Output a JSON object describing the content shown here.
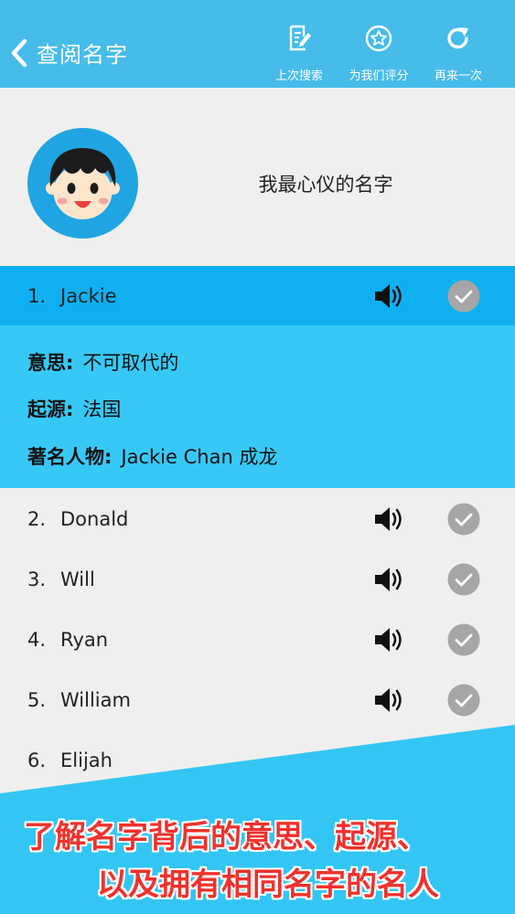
{
  "header": {
    "title": "查阅名字",
    "actions": [
      {
        "label": "上次搜索",
        "icon": "edit-document-icon"
      },
      {
        "label": "为我们评分",
        "icon": "star-icon"
      },
      {
        "label": "再来一次",
        "icon": "refresh-icon"
      }
    ],
    "color": "#46bcea"
  },
  "profile": {
    "title": "我最心仪的名字",
    "avatar_icon": "boy-avatar-icon"
  },
  "names": [
    {
      "index": "1.",
      "name": "Jackie",
      "selected": true
    },
    {
      "index": "2.",
      "name": "Donald"
    },
    {
      "index": "3.",
      "name": "Will"
    },
    {
      "index": "4.",
      "name": "Ryan"
    },
    {
      "index": "5.",
      "name": "William"
    },
    {
      "index": "6.",
      "name": "Elijah"
    }
  ],
  "detail": {
    "meaning_label": "意思:",
    "meaning_value": "不可取代的",
    "origin_label": "起源:",
    "origin_value": "法国",
    "famous_label": "著名人物:",
    "famous_value": "Jackie Chan 成龙"
  },
  "banner": {
    "line1": "了解名字背后的意思、起源、",
    "line2": "以及拥有相同名字的名人",
    "color": "#33c6f4",
    "text_color": "#f0312c"
  },
  "colors": {
    "selected_row": "#0fb0f2",
    "detail_bg": "#36c9f8",
    "check_gray": "#a6a6a6"
  }
}
